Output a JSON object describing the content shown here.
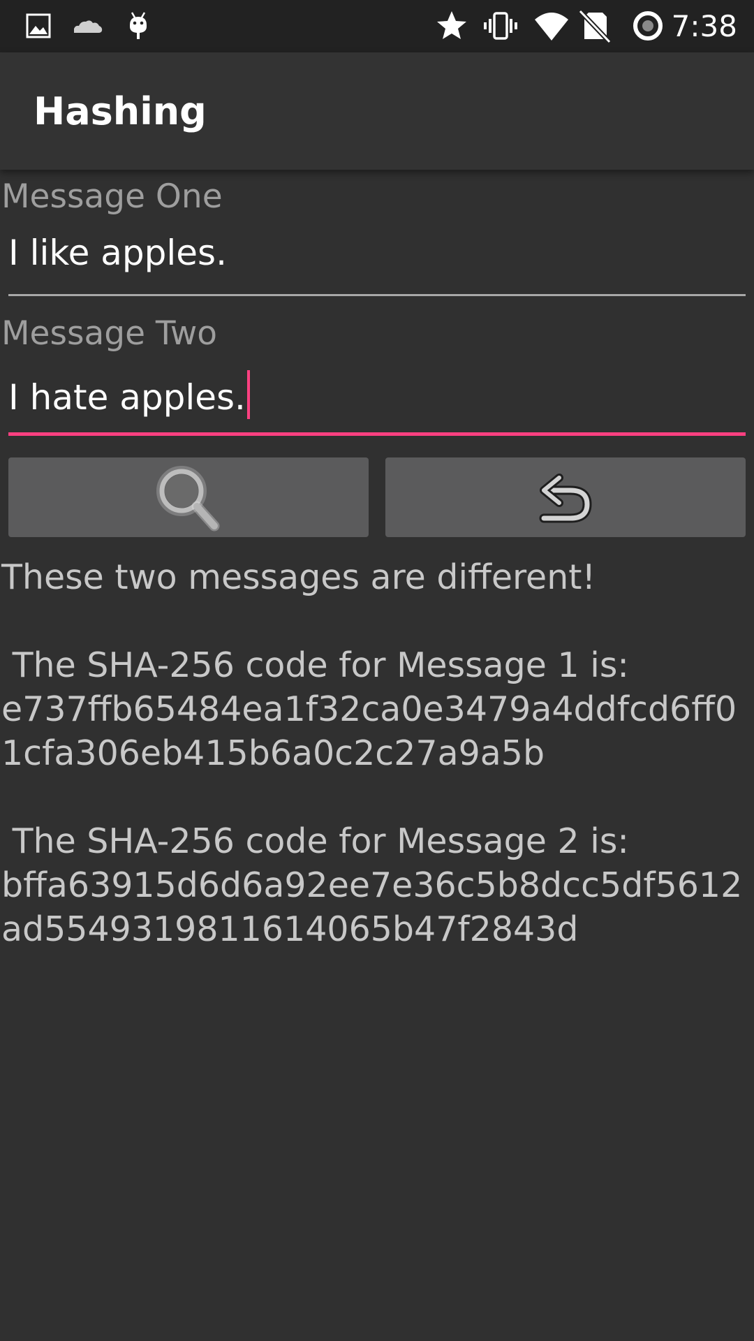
{
  "status_bar": {
    "time": "7:38",
    "left_icons": [
      "image-icon",
      "cloud-icon",
      "android-icon"
    ],
    "right_icons": [
      "star-icon",
      "vibrate-icon",
      "wifi-icon",
      "no-sim-icon",
      "battery-charging-icon"
    ]
  },
  "app_bar": {
    "title": "Hashing"
  },
  "form": {
    "message_one": {
      "label": "Message One",
      "value": "I like apples."
    },
    "message_two": {
      "label": "Message Two",
      "value": "I hate apples."
    }
  },
  "buttons": {
    "compare_icon": "search-icon",
    "reset_icon": "undo-icon"
  },
  "result": {
    "verdict": "These two messages are different!",
    "hash1_label": " The SHA-256 code for Message 1 is:",
    "hash1": "e737ffb65484ea1f32ca0e3479a4ddfcd6ff01cfa306eb415b6a0c2c27a9a5b",
    "hash2_label": " The SHA-256 code for Message 2 is:",
    "hash2": "bffa63915d6d6a92ee7e36c5b8dcc5df5612ad5549319811614065b47f2843d"
  },
  "colors": {
    "accent": "#ff4081",
    "background": "#303030",
    "app_bar": "#333333",
    "status_bar": "#222222",
    "button": "#5b5b5c"
  }
}
